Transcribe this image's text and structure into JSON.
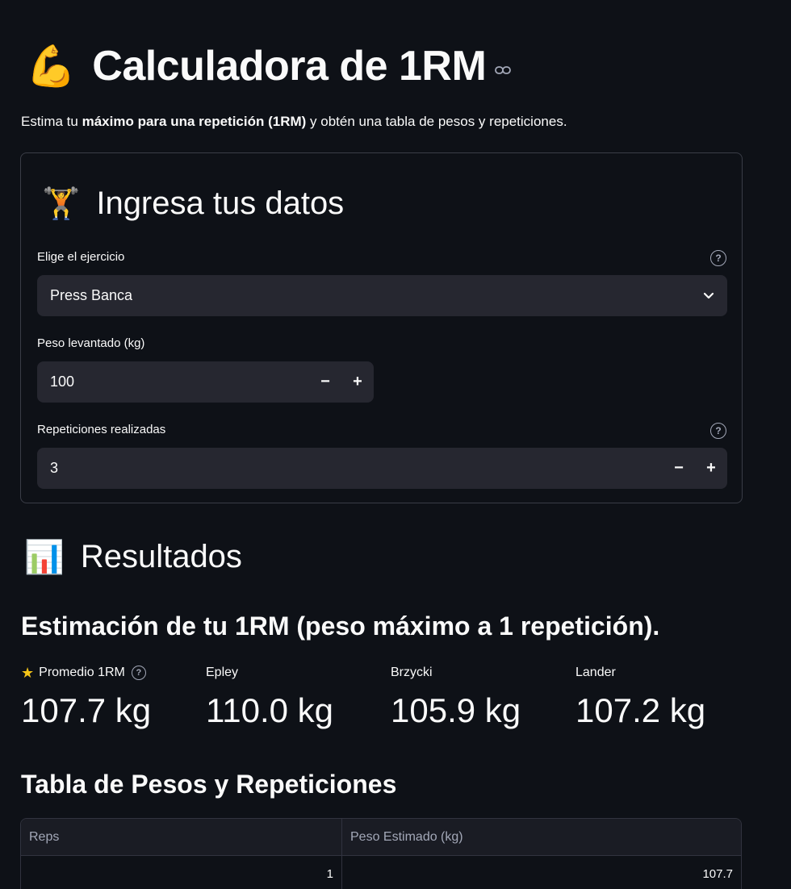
{
  "header": {
    "emoji": "💪",
    "title": "Calculadora de 1RM",
    "subtitle_pre": "Estima tu ",
    "subtitle_bold": "máximo para una repetición (1RM)",
    "subtitle_post": " y obtén una tabla de pesos y repeticiones."
  },
  "form": {
    "emoji": "🏋️",
    "title": "Ingresa tus datos",
    "exercise_label": "Elige el ejercicio",
    "exercise_value": "Press Banca",
    "weight_label": "Peso levantado (kg)",
    "weight_value": "100",
    "reps_label": "Repeticiones realizadas",
    "reps_value": "3",
    "minus": "−",
    "plus": "+"
  },
  "results": {
    "emoji": "📊",
    "title": "Resultados",
    "estimate_heading": "Estimación de tu 1RM (peso máximo a 1 repetición).",
    "metrics": [
      {
        "label": "Promedio 1RM",
        "value": "107.7 kg"
      },
      {
        "label": "Epley",
        "value": "110.0 kg"
      },
      {
        "label": "Brzycki",
        "value": "105.9 kg"
      },
      {
        "label": "Lander",
        "value": "107.2 kg"
      }
    ],
    "table_heading": "Tabla de Pesos y Repeticiones",
    "table": {
      "columns": [
        "Reps",
        "Peso Estimado (kg)"
      ],
      "rows": [
        [
          "1",
          "107.7"
        ]
      ]
    }
  }
}
